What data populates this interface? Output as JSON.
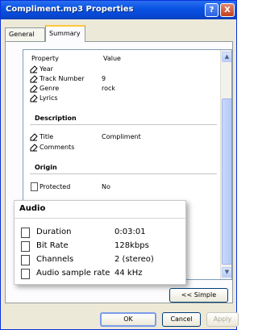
{
  "window": {
    "title": "Compliment.mp3 Properties",
    "help_label": "?",
    "close_label": "X"
  },
  "tabs": [
    {
      "label": "General"
    },
    {
      "label": "Summary"
    }
  ],
  "list": {
    "headers": {
      "property": "Property",
      "value": "Value"
    },
    "rows_top": [
      {
        "label": "Year",
        "value": ""
      },
      {
        "label": "Track Number",
        "value": "9"
      },
      {
        "label": "Genre",
        "value": "rock"
      },
      {
        "label": "Lyrics",
        "value": ""
      }
    ],
    "description": {
      "heading": "Description",
      "rows": [
        {
          "label": "Title",
          "value": "Compliment"
        },
        {
          "label": "Comments",
          "value": ""
        }
      ]
    },
    "origin": {
      "heading": "Origin",
      "rows": [
        {
          "label": "Protected",
          "value": "No"
        }
      ]
    },
    "scrollbar": {
      "up_arrow": "▲",
      "down_arrow": "▼"
    }
  },
  "popup": {
    "title": "Audio",
    "rows": [
      {
        "label": "Duration",
        "value": "0:03:01"
      },
      {
        "label": "Bit Rate",
        "value": "128kbps"
      },
      {
        "label": "Channels",
        "value": "2 (stereo)"
      },
      {
        "label": "Audio sample rate",
        "value": "44 kHz"
      }
    ]
  },
  "buttons": {
    "simple": "<< Simple",
    "ok": "OK",
    "cancel": "Cancel",
    "apply": "Apply"
  }
}
